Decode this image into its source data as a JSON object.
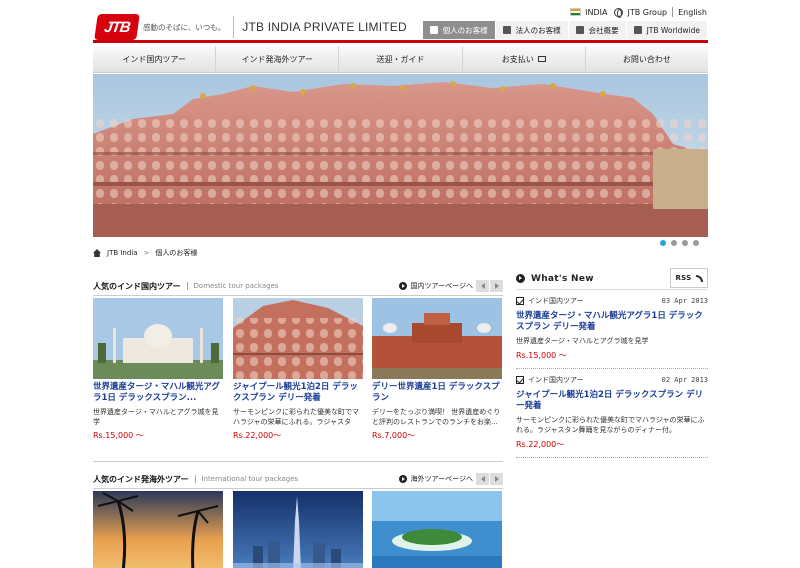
{
  "brand": {
    "logo": "JTB",
    "tagline": "感動のそばに、いつも。",
    "company": "JTB INDIA PRIVATE LIMITED"
  },
  "top_links": {
    "country": "INDIA",
    "group": "JTB Group",
    "language": "English"
  },
  "sub_nav": [
    {
      "label": "個人のお客様",
      "active": true,
      "icon": "camera-icon"
    },
    {
      "label": "法人のお客様",
      "active": false,
      "icon": "person-icon"
    },
    {
      "label": "会社概要",
      "active": false,
      "icon": "building-icon"
    },
    {
      "label": "JTB Worldwide",
      "active": false,
      "icon": "globe-icon"
    }
  ],
  "main_nav": [
    {
      "label": "インド国内ツアー"
    },
    {
      "label": "インド発海外ツアー"
    },
    {
      "label": "送迎・ガイド"
    },
    {
      "label": "お支払い",
      "external": true
    },
    {
      "label": "お問い合わせ"
    }
  ],
  "slider": {
    "count": 4,
    "active": 0
  },
  "breadcrumb": [
    "JTB India",
    "個人のお客様"
  ],
  "domestic": {
    "title": "人気のインド国内ツアー",
    "subtitle": "Domestic tour packages",
    "more": "国内ツアーページへ",
    "cards": [
      {
        "title": "世界遺産タージ・マハル観光アグラ1日 デラックスプラン...",
        "desc": "世界遺産タージ・マハルとアグラ城を見学",
        "price": "Rs.15,000 〜"
      },
      {
        "title": "ジャイプール観光1泊2日 デラックスプラン デリー発着",
        "desc": "サーモンピンクに彩られた優美な町でマハラジャの栄華にふれる。ラジャスタン...",
        "price": "Rs.22,000〜"
      },
      {
        "title": "デリー世界遺産1日 デラックスプラン",
        "desc": "デリーをたっぷり満喫！ 世界遺産めぐりと評判のレストランでのランチをお楽...",
        "price": "Rs.7,000〜"
      }
    ]
  },
  "overseas": {
    "title": "人気のインド発海外ツアー",
    "subtitle": "International tour packages",
    "more": "海外ツアーページへ"
  },
  "whats_new": {
    "title": "What's New",
    "rss": "RSS",
    "items": [
      {
        "category": "インド国内ツアー",
        "date": "03 Apr 2013",
        "title": "世界遺産タージ・マハル観光アグラ1日 デラックスプラン デリー発着",
        "desc": "世界遺産タージ・マハルとアグラ城を見学",
        "price": "Rs.15,000 〜"
      },
      {
        "category": "インド国内ツアー",
        "date": "02 Apr 2013",
        "title": "ジャイプール観光1泊2日 デラックスプラン デリー発着",
        "desc": "サーモンピンクに彩られた優美な町でマハラジャの栄華にふれる。ラジャスタン舞踊を見ながらのディナー付。",
        "price": "Rs.22,000〜"
      }
    ]
  },
  "colors": {
    "accent_red": "#c8000a",
    "link_blue": "#1a3c98",
    "price_red": "#cc0000",
    "dot_active": "#2aa4d4"
  }
}
